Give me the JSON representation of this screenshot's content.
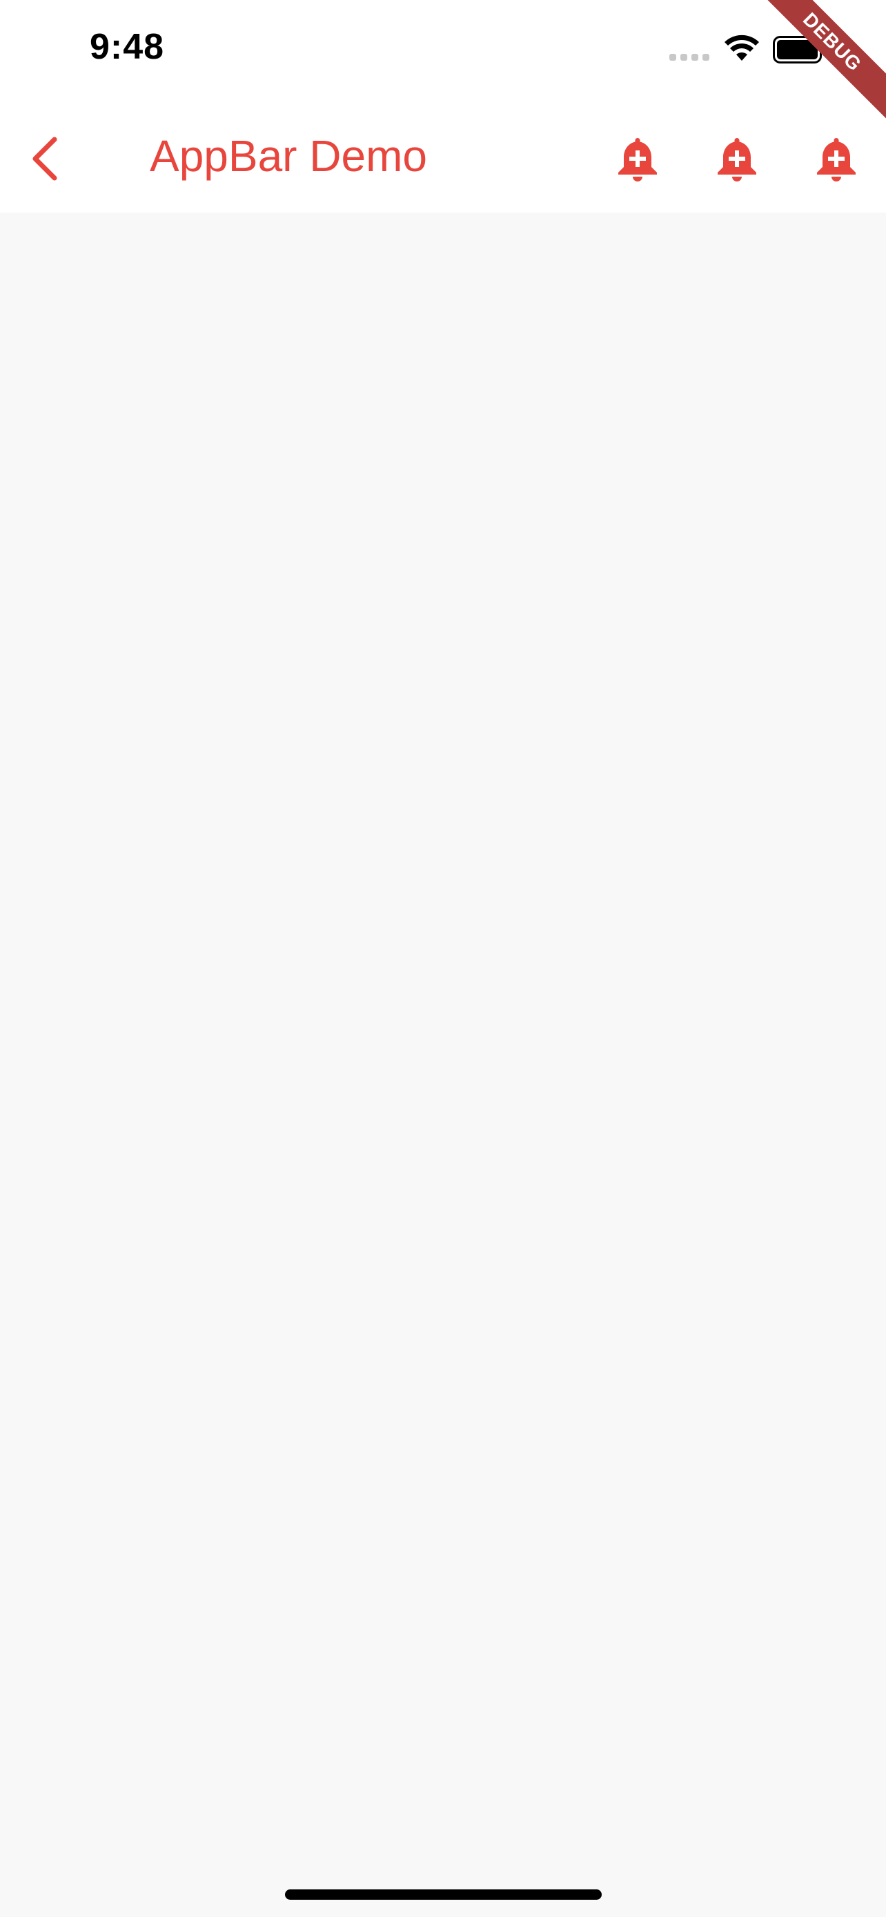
{
  "status_bar": {
    "time": "9:48"
  },
  "app_bar": {
    "title": "AppBar Demo",
    "back_icon": "chevron-left-icon",
    "actions": [
      {
        "icon": "add-alert-bell-icon"
      },
      {
        "icon": "add-alert-bell-icon"
      },
      {
        "icon": "add-alert-bell-icon"
      }
    ]
  },
  "debug_banner": {
    "label": "DEBUG"
  },
  "colors": {
    "accent": "#e8453c",
    "app_bar_background": "#ffffff",
    "body_background": "#f8f8f8",
    "debug_banner": "#a83a3a"
  }
}
